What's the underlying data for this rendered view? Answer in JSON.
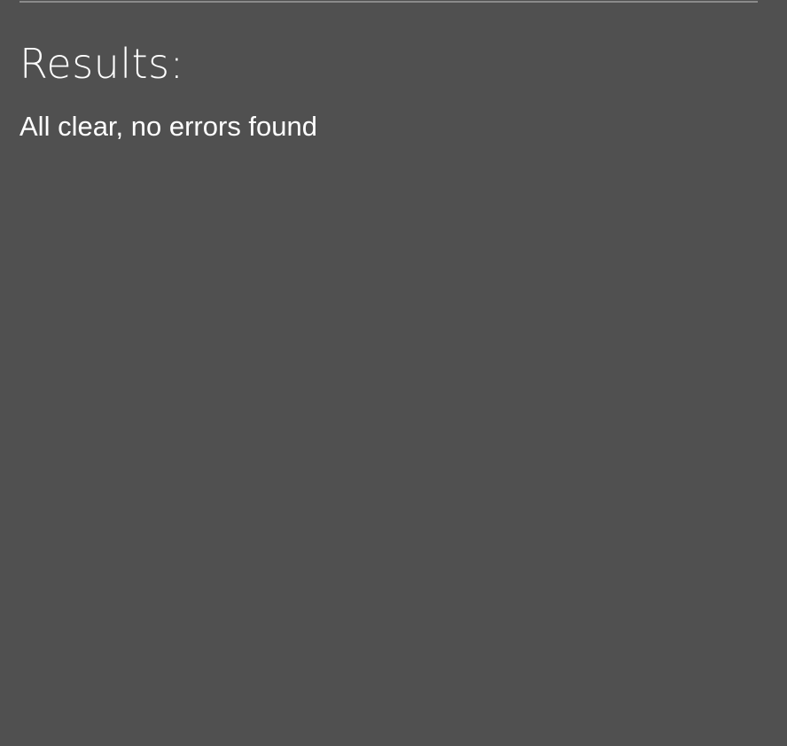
{
  "results": {
    "heading": "Results:",
    "message": "All clear, no errors found"
  },
  "colors": {
    "background": "#505050",
    "divider": "#8a8a8a",
    "text": "#ffffff"
  }
}
